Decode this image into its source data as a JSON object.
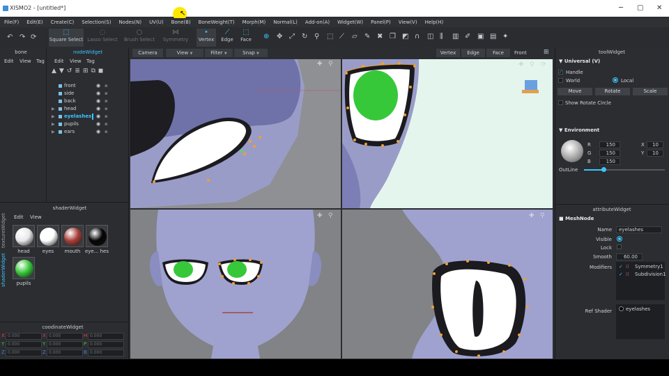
{
  "window": {
    "title": "XISMO2 - [untitled*]",
    "controls": [
      "─",
      "▢",
      "✕"
    ]
  },
  "menu": [
    "File(F)",
    "Edit(E)",
    "Create(C)",
    "Selection(S)",
    "Nodes(N)",
    "UV(U)",
    "Bone(B)",
    "BoneWeight(T)",
    "Morph(M)",
    "Normal(L)",
    "Add-on(A)",
    "Widget(W)",
    "Panel(P)",
    "View(V)",
    "Help(H)"
  ],
  "toolbar": {
    "modes": [
      {
        "label": "Square Select",
        "icon": "square-select-icon"
      },
      {
        "label": "Lasso Select",
        "icon": "lasso-icon"
      },
      {
        "label": "Brush Select",
        "icon": "brush-icon"
      },
      {
        "label": "Symmetry",
        "icon": "symmetry-icon"
      },
      {
        "label": "Vertex",
        "icon": "vertex-icon"
      },
      {
        "label": "Edge",
        "icon": "edge-icon"
      },
      {
        "label": "Face",
        "icon": "face-icon"
      }
    ]
  },
  "bone_panel": {
    "title": "bone",
    "menu": [
      "Edit",
      "View",
      "Tag"
    ]
  },
  "node_widget": {
    "title": "nodeWidget",
    "menu": [
      "Edit",
      "View",
      "Tag"
    ],
    "nodes": [
      {
        "name": "front",
        "expandable": false,
        "selected": false
      },
      {
        "name": "side",
        "expandable": false,
        "selected": false
      },
      {
        "name": "back",
        "expandable": false,
        "selected": false
      },
      {
        "name": "head",
        "expandable": true,
        "selected": false
      },
      {
        "name": "eyelashes",
        "expandable": true,
        "selected": true
      },
      {
        "name": "pupils",
        "expandable": true,
        "selected": false
      },
      {
        "name": "ears",
        "expandable": true,
        "selected": false
      }
    ]
  },
  "shader_widget": {
    "title": "shaderWidget",
    "menu": [
      "Edit",
      "View"
    ],
    "tabs": [
      "textureWidget",
      "shaderWidget"
    ],
    "shaders": [
      {
        "name": "head",
        "color": "#e8e8ea"
      },
      {
        "name": "eyes",
        "color": "#ffffff"
      },
      {
        "name": "mouth",
        "color": "#a8403a"
      },
      {
        "name": "eye... hes",
        "color": "#050505"
      },
      {
        "name": "pupils",
        "color": "#37c83a"
      }
    ]
  },
  "coord_widget": {
    "title": "coodinateWidget",
    "rows": [
      [
        {
          "axis": "X",
          "value": "0.000"
        },
        {
          "axis": "X",
          "value": "0.000"
        },
        {
          "axis": "H",
          "value": "0.000"
        }
      ],
      [
        {
          "axis": "Y",
          "value": "0.000"
        },
        {
          "axis": "Y",
          "value": "0.000"
        },
        {
          "axis": "P",
          "value": "0.000"
        }
      ],
      [
        {
          "axis": "Z",
          "value": "0.000"
        },
        {
          "axis": "Z",
          "value": "0.000"
        },
        {
          "axis": "B",
          "value": "0.000"
        }
      ]
    ]
  },
  "viewport_header": {
    "left": [
      {
        "label": "Camera",
        "dropdown": false
      },
      {
        "label": "View",
        "dropdown": true
      },
      {
        "label": "Filter",
        "dropdown": true
      },
      {
        "label": "Snap",
        "dropdown": true
      }
    ],
    "right": [
      "Vertex",
      "Edge",
      "Face"
    ],
    "view_name": "Front"
  },
  "tool_widget": {
    "title": "toolWidget",
    "universal_label": "Universal (V)",
    "handle_label": "Handle",
    "world_label": "World",
    "local_label": "Local",
    "buttons": [
      "Move",
      "Rotate",
      "Scale"
    ],
    "show_rotate_label": "Show Rotate Circle",
    "environment_label": "Environment",
    "rgb": [
      {
        "k": "R",
        "v": "150"
      },
      {
        "k": "G",
        "v": "150"
      },
      {
        "k": "B",
        "v": "150"
      }
    ],
    "xy": [
      {
        "k": "X",
        "v": "10"
      },
      {
        "k": "Y",
        "v": "10"
      }
    ],
    "outline_label": "OutLine",
    "outline_level": 0.24
  },
  "attribute_widget": {
    "title": "attributeWidget",
    "node_type": "MeshNode",
    "name_label": "Name",
    "name_value": "eyelashes",
    "visible_label": "Visible",
    "lock_label": "Lock",
    "smooth_label": "Smooth",
    "smooth_value": "60.00",
    "modifiers_label": "Modifiers",
    "modifiers": [
      "Symmetry1",
      "Subdivision1"
    ],
    "ref_shader_label": "Ref Shader",
    "ref_shader_value": "eyelashes"
  },
  "colors": {
    "accent": "#3ec3ff",
    "panel": "#2b2d30",
    "vertex": "#f0a030"
  }
}
